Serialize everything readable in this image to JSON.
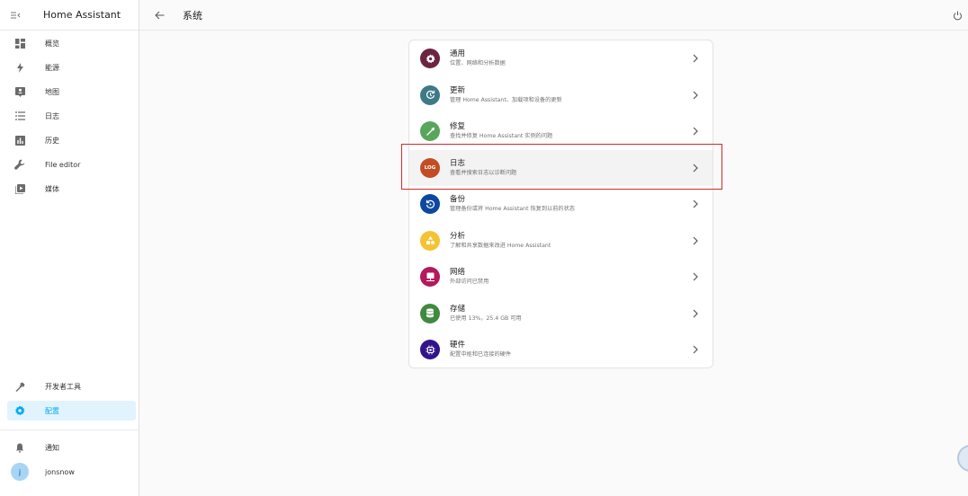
{
  "app": {
    "title": "Home Assistant"
  },
  "page": {
    "title": "系统"
  },
  "sidebar": {
    "items": [
      {
        "label": "概览"
      },
      {
        "label": "能源"
      },
      {
        "label": "地图"
      },
      {
        "label": "日志"
      },
      {
        "label": "历史"
      },
      {
        "label": "File editor"
      },
      {
        "label": "媒体"
      }
    ],
    "bottom": [
      {
        "label": "开发者工具"
      },
      {
        "label": "配置"
      }
    ],
    "notifications": {
      "label": "通知"
    },
    "user": {
      "name": "jonsnow",
      "initial": "j"
    }
  },
  "settings": {
    "rows": [
      {
        "title": "通用",
        "subtitle": "位置、网络和分析数据",
        "color": "#6d2441",
        "icon": "gear-icon"
      },
      {
        "title": "更新",
        "subtitle": "管理 Home Assistant、加载项和设备的更新",
        "color": "#3e7a86",
        "icon": "update-icon"
      },
      {
        "title": "修复",
        "subtitle": "查找并修复 Home Assistant 实例的问题",
        "color": "#57a65a",
        "icon": "wrench-icon"
      },
      {
        "title": "日志",
        "subtitle": "查看并搜索日志以诊断问题",
        "color": "#c24d25",
        "icon": "log-icon",
        "icon_text": "LOG"
      },
      {
        "title": "备份",
        "subtitle": "管理备份或将 Home Assistant 恢复到以前的状态",
        "color": "#0d47a1",
        "icon": "backup-icon"
      },
      {
        "title": "分析",
        "subtitle": "了解和共享数据来改进 Home Assistant",
        "color": "#f5c332",
        "icon": "analytics-icon"
      },
      {
        "title": "网络",
        "subtitle": "外部访问已禁用",
        "color": "#b4195b",
        "icon": "network-icon"
      },
      {
        "title": "存储",
        "subtitle": "已使用 13%，25.4 GB 可用",
        "color": "#3f8a3f",
        "icon": "storage-icon"
      },
      {
        "title": "硬件",
        "subtitle": "配置中枢和已连接的硬件",
        "color": "#31148c",
        "icon": "chip-icon"
      }
    ]
  }
}
